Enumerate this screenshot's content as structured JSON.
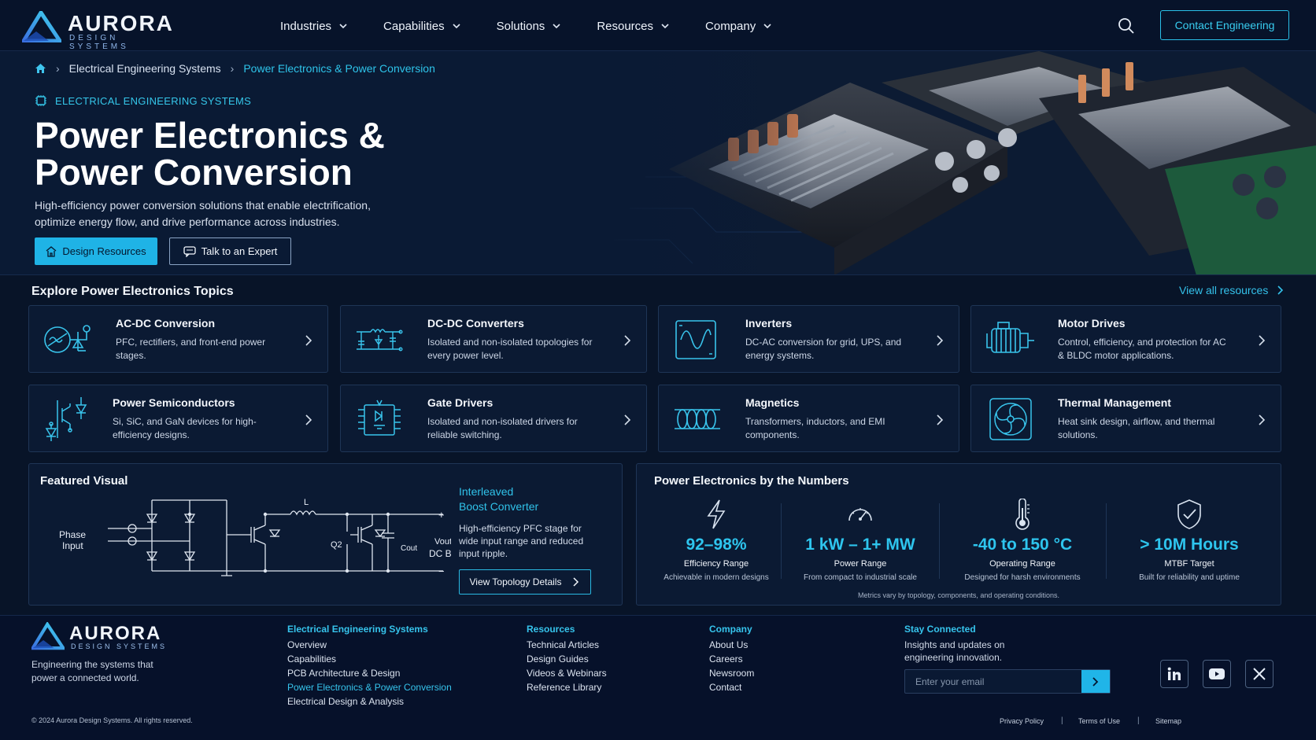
{
  "brand": {
    "name": "AURORA",
    "tagline": "DESIGN SYSTEMS"
  },
  "nav": {
    "items": [
      "Industries",
      "Capabilities",
      "Solutions",
      "Resources",
      "Company"
    ],
    "cta": "Contact Engineering"
  },
  "breadcrumb": {
    "items": [
      "Electrical Engineering Systems",
      "Power Electronics & Power Conversion"
    ]
  },
  "hero": {
    "eyebrow": "ELECTRICAL ENGINEERING SYSTEMS",
    "title_line1": "Power Electronics &",
    "title_line2": "Power Conversion",
    "description": "High-efficiency power conversion solutions that enable electrification, optimize energy flow, and drive performance across industries.",
    "primary_button": "Design Resources",
    "secondary_button": "Talk to an Expert"
  },
  "topics": {
    "heading": "Explore Power Electronics Topics",
    "view_all": "View all resources",
    "cards": [
      {
        "title": "AC-DC Conversion",
        "desc": "PFC, rectifiers, and front-end power stages."
      },
      {
        "title": "DC-DC Converters",
        "desc": "Isolated and non-isolated topologies for every power level."
      },
      {
        "title": "Inverters",
        "desc": "DC-AC conversion for grid, UPS, and energy systems."
      },
      {
        "title": "Motor Drives",
        "desc": "Control, efficiency, and protection for AC & BLDC motor applications."
      },
      {
        "title": "Power Semiconductors",
        "desc": "Si, SiC, and GaN devices for high-efficiency designs."
      },
      {
        "title": "Gate Drivers",
        "desc": "Isolated and non-isolated drivers for reliable switching."
      },
      {
        "title": "Magnetics",
        "desc": "Transformers, inductors, and EMI components."
      },
      {
        "title": "Thermal Management",
        "desc": "Heat sink design, airflow, and thermal solutions."
      }
    ]
  },
  "featured": {
    "heading": "Featured Visual",
    "diagram_labels": {
      "phase_input_1": "Phase",
      "phase_input_2": "Input",
      "inductor": "L",
      "switch": "Q2",
      "cap": "Cout",
      "vout": "Vout",
      "dc_bus": "DC Bus",
      "plus": "+",
      "minus": "−"
    },
    "title_line1": "Interleaved",
    "title_line2": "Boost Converter",
    "description": "High-efficiency PFC stage for wide input range and reduced input ripple.",
    "button": "View Topology Details"
  },
  "numbers": {
    "heading": "Power Electronics by the Numbers",
    "stats": [
      {
        "value": "92–98%",
        "label": "Efficiency Range",
        "sub": "Achievable in modern designs",
        "icon": "lightning-icon"
      },
      {
        "value": "1 kW – 1+ MW",
        "label": "Power Range",
        "sub": "From compact to industrial scale",
        "icon": "gauge-icon"
      },
      {
        "value": "-40 to 150 °C",
        "label": "Operating Range",
        "sub": "Designed for harsh environments",
        "icon": "thermometer-icon"
      },
      {
        "value": "> 10M Hours",
        "label": "MTBF Target",
        "sub": "Built for reliability and uptime",
        "icon": "shield-check-icon"
      }
    ],
    "note": "Metrics vary by topology, components, and operating conditions."
  },
  "footer": {
    "tagline": "Engineering the systems that power a connected world.",
    "col1": {
      "heading": "Electrical Engineering Systems",
      "links": [
        "Overview",
        "Capabilities",
        "PCB Architecture & Design",
        "Power Electronics & Power Conversion",
        "Electrical Design & Analysis"
      ]
    },
    "col2": {
      "heading": "Resources",
      "links": [
        "Technical Articles",
        "Design Guides",
        "Videos & Webinars",
        "Reference Library"
      ]
    },
    "col3": {
      "heading": "Company",
      "links": [
        "About Us",
        "Careers",
        "Newsroom",
        "Contact"
      ]
    },
    "stay": {
      "heading": "Stay Connected",
      "text": "Insights and updates on engineering innovation.",
      "placeholder": "Enter your email"
    },
    "copyright": "© 2024 Aurora Design Systems. All rights reserved.",
    "legal": [
      "Privacy Policy",
      "Terms of Use",
      "Sitemap"
    ]
  },
  "colors": {
    "background": "#081428",
    "accent": "#2ec4ea",
    "primary_button": "#1fb3e6"
  }
}
